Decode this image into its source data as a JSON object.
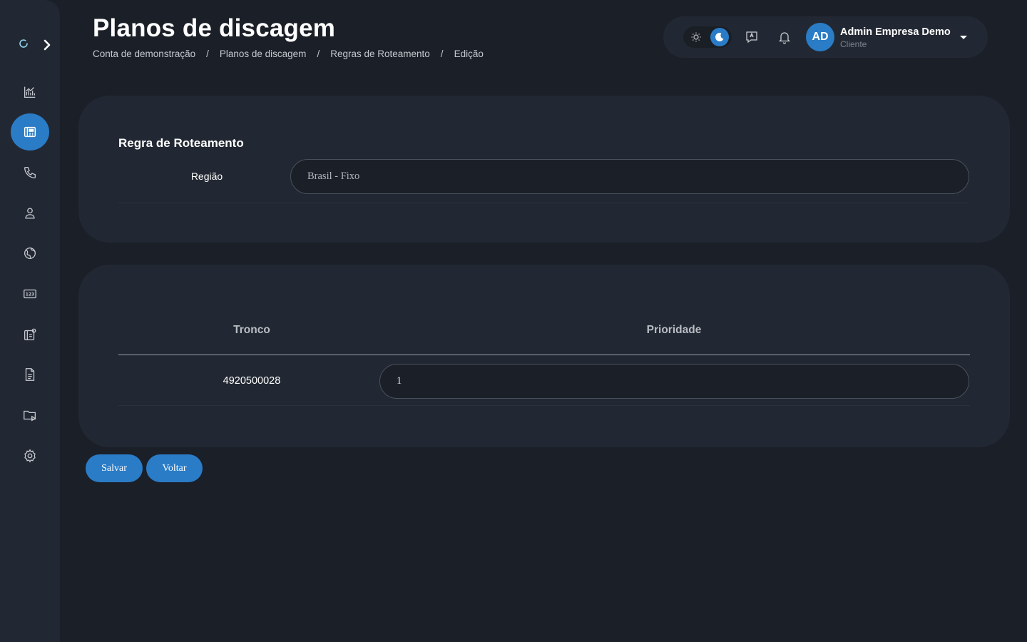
{
  "header": {
    "title": "Planos de discagem",
    "breadcrumb": [
      "Conta de demonstração",
      "Planos de discagem",
      "Regras de Roteamento",
      "Edição"
    ],
    "breadcrumb_separator": "/"
  },
  "user": {
    "initials": "AD",
    "name": "Admin Empresa Demo",
    "role": "Cliente"
  },
  "sidebar": {
    "items": [
      {
        "icon": "chart-icon"
      },
      {
        "icon": "dialplan-icon",
        "active": true
      },
      {
        "icon": "phone-icon"
      },
      {
        "icon": "user-icon"
      },
      {
        "icon": "globe-icon"
      },
      {
        "icon": "numbers-icon"
      },
      {
        "icon": "ivr-icon"
      },
      {
        "icon": "document-icon"
      },
      {
        "icon": "media-folder-icon"
      },
      {
        "icon": "gear-icon"
      }
    ]
  },
  "routing_rule": {
    "title": "Regra de Roteamento",
    "region_label": "Região",
    "region_value": "Brasil - Fixo"
  },
  "trunk_table": {
    "columns": [
      "Tronco",
      "Prioridade"
    ],
    "rows": [
      {
        "tronco": "4920500028",
        "prioridade": "1"
      }
    ]
  },
  "actions": {
    "save_label": "Salvar",
    "back_label": "Voltar"
  },
  "colors": {
    "background": "#1b1f27",
    "panel": "#222833",
    "accent": "#2a7cc7"
  }
}
